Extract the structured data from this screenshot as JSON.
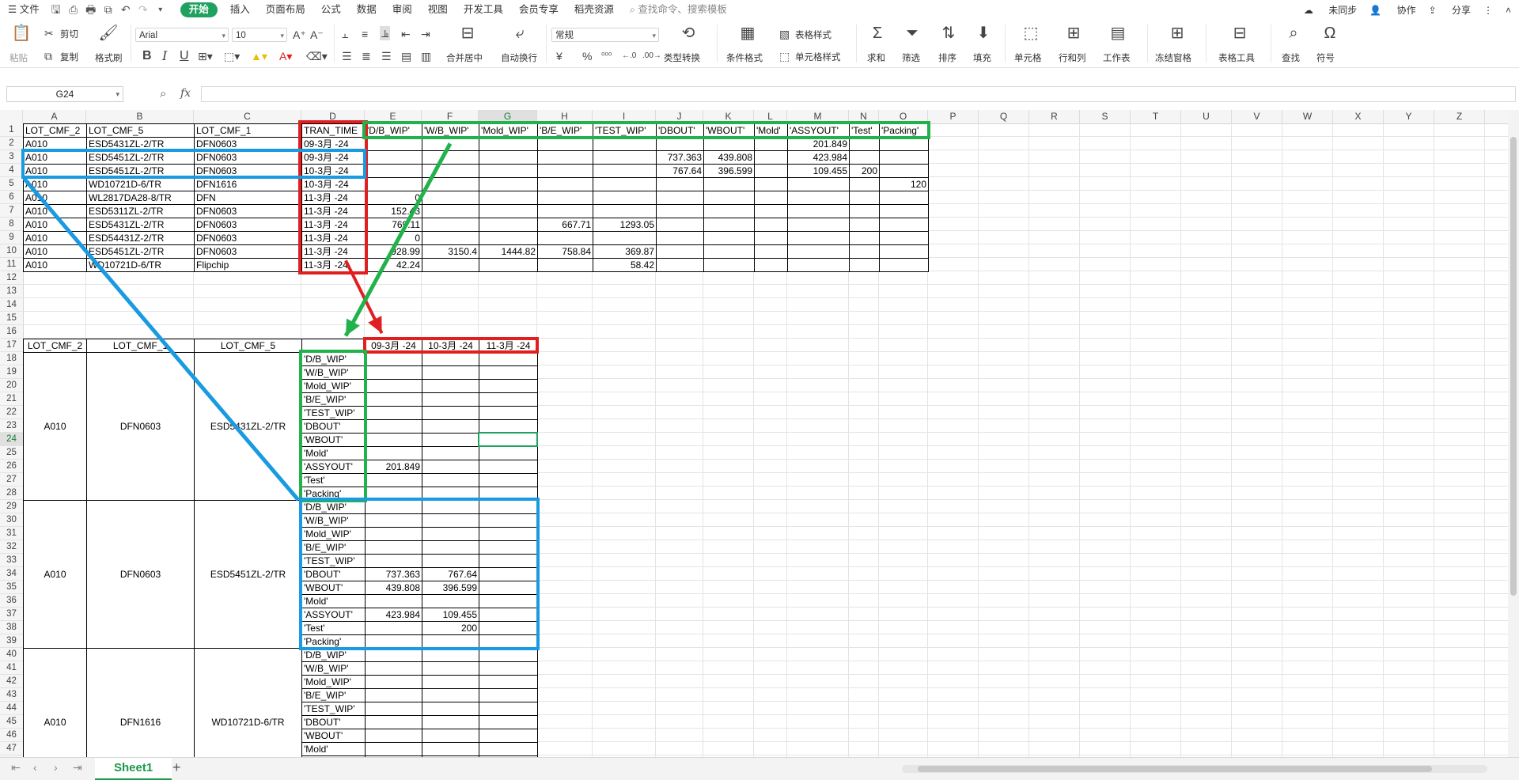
{
  "menu": {
    "file": "文件",
    "tabs": [
      "开始",
      "插入",
      "页面布局",
      "公式",
      "数据",
      "审阅",
      "视图",
      "开发工具",
      "会员专享",
      "稻壳资源"
    ],
    "search_placeholder": "查找命令、搜索模板",
    "sync": "未同步",
    "collab": "协作",
    "share": "分享"
  },
  "toolbar": {
    "paste": "粘贴",
    "cut": "剪切",
    "copy": "复制",
    "format_painter": "格式刷",
    "font_name": "Arial",
    "font_size": "10",
    "merge_center": "合并居中",
    "wrap_text": "自动换行",
    "number_format": "常规",
    "type_convert": "类型转换",
    "cond_format": "条件格式",
    "table_style": "表格样式",
    "cell_style": "单元格样式",
    "sum": "求和",
    "filter": "筛选",
    "sort": "排序",
    "fill": "填充",
    "cell": "单元格",
    "row_col": "行和列",
    "worksheet": "工作表",
    "freeze": "冻结窗格",
    "table_tools": "表格工具",
    "find": "查找",
    "symbol": "符号",
    "bold": "B",
    "italic": "I",
    "underline": "U",
    "percent": "%",
    "yuan": "¥"
  },
  "formula_bar": {
    "name_box": "G24",
    "fx": "fx",
    "formula": ""
  },
  "columns": [
    "A",
    "B",
    "C",
    "D",
    "E",
    "F",
    "G",
    "H",
    "I",
    "J",
    "K",
    "L",
    "M",
    "N",
    "O",
    "P",
    "Q",
    "R",
    "S",
    "T",
    "U",
    "V",
    "W",
    "X",
    "Y",
    "Z"
  ],
  "selected_column": "G",
  "rows": [
    "1",
    "2",
    "3",
    "4",
    "5",
    "6",
    "7",
    "8",
    "9",
    "10",
    "11",
    "12",
    "13",
    "14",
    "15",
    "16",
    "17",
    "18",
    "19",
    "20",
    "21",
    "22",
    "23",
    "24",
    "25",
    "26",
    "27",
    "28",
    "29",
    "30",
    "31",
    "32",
    "33",
    "34",
    "35",
    "36",
    "37",
    "38",
    "39",
    "40",
    "41",
    "42",
    "43",
    "44",
    "45",
    "46",
    "47"
  ],
  "selected_row": "24",
  "top_table": {
    "headers": [
      "LOT_CMF_2",
      "LOT_CMF_5",
      "LOT_CMF_1",
      "TRAN_TIME",
      "'D/B_WIP'",
      "'W/B_WIP'",
      "'Mold_WIP'",
      "'B/E_WIP'",
      "'TEST_WIP'",
      "'DBOUT'",
      "'WBOUT'",
      "'Mold'",
      "'ASSYOUT'",
      "'Test'",
      "'Packing'"
    ],
    "rows": [
      [
        "A010",
        "ESD5431ZL-2/TR",
        "DFN0603",
        "09-3月 -24",
        "",
        "",
        "",
        "",
        "",
        "",
        "",
        "",
        "201.849",
        "",
        ""
      ],
      [
        "A010",
        "ESD5451ZL-2/TR",
        "DFN0603",
        "09-3月 -24",
        "",
        "",
        "",
        "",
        "",
        "737.363",
        "439.808",
        "",
        "423.984",
        "",
        ""
      ],
      [
        "A010",
        "ESD5451ZL-2/TR",
        "DFN0603",
        "10-3月 -24",
        "",
        "",
        "",
        "",
        "",
        "767.64",
        "396.599",
        "",
        "109.455",
        "200",
        ""
      ],
      [
        "A010",
        "WD10721D-6/TR",
        "DFN1616",
        "10-3月 -24",
        "",
        "",
        "",
        "",
        "",
        "",
        "",
        "",
        "",
        "",
        "120"
      ],
      [
        "A010",
        "WL2817DA28-8/TR",
        "DFN",
        "11-3月 -24",
        "0",
        "",
        "",
        "",
        "",
        "",
        "",
        "",
        "",
        "",
        ""
      ],
      [
        "A010",
        "ESD5311ZL-2/TR",
        "DFN0603",
        "11-3月 -24",
        "152.43",
        "",
        "",
        "",
        "",
        "",
        "",
        "",
        "",
        "",
        ""
      ],
      [
        "A010",
        "ESD5431ZL-2/TR",
        "DFN0603",
        "11-3月 -24",
        "769.11",
        "",
        "",
        "667.71",
        "1293.05",
        "",
        "",
        "",
        "",
        "",
        ""
      ],
      [
        "A010",
        "ESD54431Z-2/TR",
        "DFN0603",
        "11-3月 -24",
        "0",
        "",
        "",
        "",
        "",
        "",
        "",
        "",
        "",
        "",
        ""
      ],
      [
        "A010",
        "ESD5451ZL-2/TR",
        "DFN0603",
        "11-3月 -24",
        "928.99",
        "3150.4",
        "1444.82",
        "758.84",
        "369.87",
        "",
        "",
        "",
        "",
        "",
        ""
      ],
      [
        "A010",
        "WD10721D-6/TR",
        "Flipchip",
        "11-3月 -24",
        "42.24",
        "",
        "",
        "",
        "58.42",
        "",
        "",
        "",
        "",
        "",
        ""
      ]
    ]
  },
  "pivot": {
    "headers": [
      "LOT_CMF_2",
      "LOT_CMF_1",
      "LOT_CMF_5"
    ],
    "dates": [
      "09-3月 -24",
      "10-3月 -24",
      "11-3月 -24"
    ],
    "metrics": [
      "'D/B_WIP'",
      "'W/B_WIP'",
      "'Mold_WIP'",
      "'B/E_WIP'",
      "'TEST_WIP'",
      "'DBOUT'",
      "'WBOUT'",
      "'Mold'",
      "'ASSYOUT'",
      "'Test'",
      "'Packing'"
    ],
    "groups": [
      {
        "a": "A010",
        "b": "DFN0603",
        "c": "ESD5431ZL-2/TR",
        "values": [
          [
            "",
            "",
            ""
          ],
          [
            "",
            "",
            ""
          ],
          [
            "",
            "",
            ""
          ],
          [
            "",
            "",
            ""
          ],
          [
            "",
            "",
            ""
          ],
          [
            "",
            "",
            ""
          ],
          [
            "",
            "",
            ""
          ],
          [
            "",
            "",
            ""
          ],
          [
            "201.849",
            "",
            ""
          ],
          [
            "",
            "",
            ""
          ],
          [
            "",
            "",
            ""
          ]
        ]
      },
      {
        "a": "A010",
        "b": "DFN0603",
        "c": "ESD5451ZL-2/TR",
        "values": [
          [
            "",
            "",
            ""
          ],
          [
            "",
            "",
            ""
          ],
          [
            "",
            "",
            ""
          ],
          [
            "",
            "",
            ""
          ],
          [
            "",
            "",
            ""
          ],
          [
            "737.363",
            "767.64",
            ""
          ],
          [
            "439.808",
            "396.599",
            ""
          ],
          [
            "",
            "",
            ""
          ],
          [
            "423.984",
            "109.455",
            ""
          ],
          [
            "",
            "200",
            ""
          ],
          [
            "",
            "",
            ""
          ]
        ]
      },
      {
        "a": "A010",
        "b": "DFN1616",
        "c": "WD10721D-6/TR",
        "values": [
          [
            "",
            "",
            ""
          ],
          [
            "",
            "",
            ""
          ],
          [
            "",
            "",
            ""
          ],
          [
            "",
            "",
            ""
          ],
          [
            "",
            "",
            ""
          ],
          [
            "",
            "",
            ""
          ],
          [
            "",
            "",
            ""
          ],
          [
            "",
            "",
            ""
          ],
          [
            "",
            "",
            ""
          ],
          [
            "",
            "",
            ""
          ],
          [
            "",
            "",
            ""
          ]
        ]
      }
    ]
  },
  "sheets": [
    "Sheet1"
  ],
  "annotation_colors": {
    "red": "#e02020",
    "green": "#22b24c",
    "blue": "#1a9ae0"
  }
}
